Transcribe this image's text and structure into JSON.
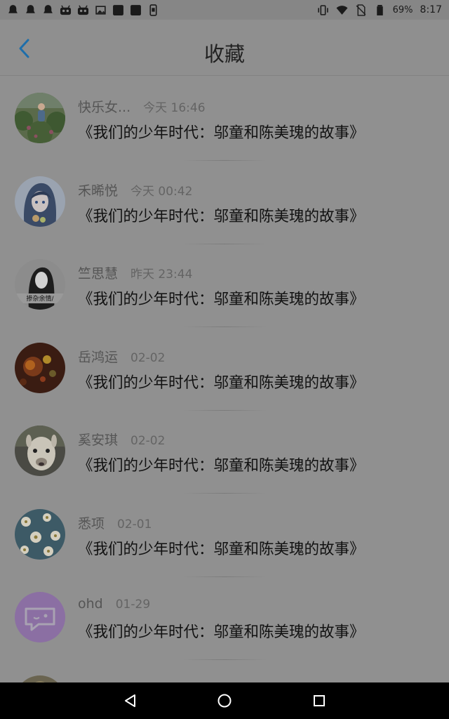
{
  "status_bar": {
    "battery": "69%",
    "time": "8:17",
    "left_icons": [
      "notification-icon",
      "notification-icon",
      "notification-icon",
      "robot-icon",
      "robot-icon",
      "image-icon",
      "app-icon",
      "app-icon",
      "phone-icon"
    ],
    "right_icons": [
      "vibrate-icon",
      "wifi-icon",
      "no-sim-icon",
      "battery-icon"
    ]
  },
  "header": {
    "title": "收藏",
    "back_icon": "back-arrow-icon",
    "accent": "#1e6eaa"
  },
  "list": {
    "items": [
      {
        "name": "快乐女...",
        "time": "今天 16:46",
        "content": "《我们的少年时代：邬童和陈美瑰的故事》",
        "avatar": "green-garden-photo"
      },
      {
        "name": "禾晞悦",
        "time": "今天 00:42",
        "content": "《我们的少年时代：邬童和陈美瑰的故事》",
        "avatar": "anime-girl"
      },
      {
        "name": "竺思慧",
        "time": "昨天 23:44",
        "content": "《我们的少年时代：邬童和陈美瑰的故事》",
        "avatar": "sketch-girl",
        "avatar_caption": "掺杂余情/"
      },
      {
        "name": "岳鸿运",
        "time": "02-02",
        "content": "《我们的少年时代：邬童和陈美瑰的故事》",
        "avatar": "bokeh-lights"
      },
      {
        "name": "奚安琪",
        "time": "02-02",
        "content": "《我们的少年时代：邬童和陈美瑰的故事》",
        "avatar": "alpaca"
      },
      {
        "name": "悉项",
        "time": "02-01",
        "content": "《我们的少年时代：邬童和陈美瑰的故事》",
        "avatar": "floral-pattern"
      },
      {
        "name": "ohd",
        "time": "01-29",
        "content": "《我们的少年时代：邬童和陈美瑰的故事》",
        "avatar": "chat-bubble-default"
      },
      {
        "name": "",
        "time": "",
        "content": "",
        "avatar": "partial-photo"
      }
    ]
  },
  "nav_bar": {
    "back": "triangle-back-icon",
    "home": "circle-home-icon",
    "recents": "square-recents-icon"
  }
}
